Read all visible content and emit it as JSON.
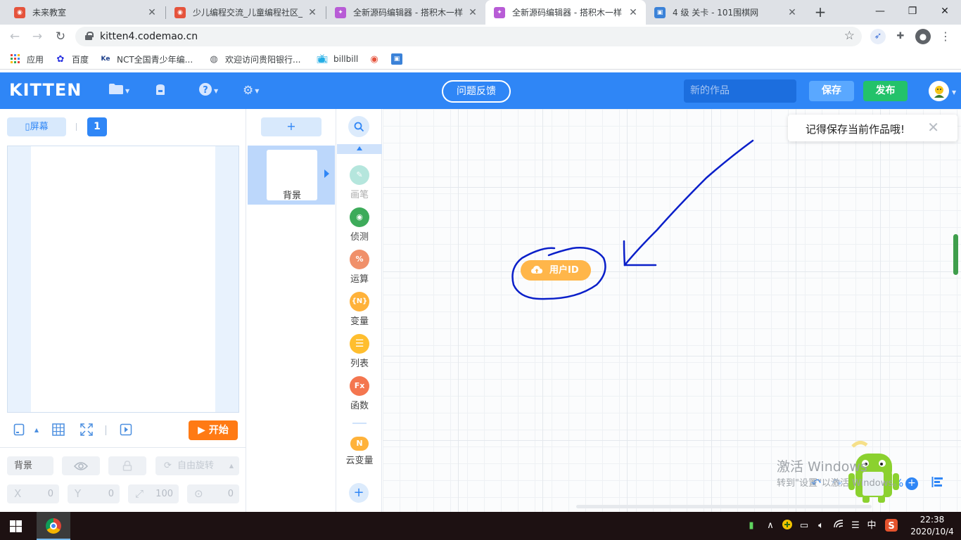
{
  "browser": {
    "tabs": [
      {
        "title": "未来教室",
        "active": false
      },
      {
        "title": "少儿编程交流_儿童编程社区_",
        "active": false
      },
      {
        "title": "全新源码编辑器 - 搭积木一样",
        "active": false
      },
      {
        "title": "全新源码编辑器 - 搭积木一样",
        "active": true
      },
      {
        "title": "4 级 关卡 - 101围棋网",
        "active": false
      }
    ],
    "new_tab": "+",
    "url": "kitten4.codemao.cn",
    "bookmarks": [
      {
        "label": "应用",
        "icon": "apps-grid-icon"
      },
      {
        "label": "百度",
        "icon": "baidu-paw-icon"
      },
      {
        "label": "NCT全国青少年编...",
        "icon": "nct-icon"
      },
      {
        "label": "欢迎访问贵阳银行...",
        "icon": "globe-icon"
      },
      {
        "label": "billbill",
        "icon": "bilibili-tv-icon"
      },
      {
        "label": "",
        "icon": "codemao-icon"
      },
      {
        "label": "",
        "icon": "image-icon"
      }
    ]
  },
  "app": {
    "logo": "KITTEN",
    "feedback": "问题反馈",
    "project_name_placeholder": "新的作品",
    "save": "保存",
    "publish": "发布",
    "accent": "#2f86f6"
  },
  "stage": {
    "screen_button": "屏幕",
    "page_number": "1",
    "start_button": "开始",
    "props": {
      "name": "背景",
      "rotate": "自由旋转",
      "x_label": "X",
      "x_value": "0",
      "y_label": "Y",
      "y_value": "0",
      "size_value": "100",
      "direction_value": "0"
    }
  },
  "sprites": {
    "add": "+",
    "items": [
      {
        "label": "背景",
        "selected": true
      }
    ]
  },
  "categories": [
    {
      "label": "画笔",
      "color": "#5cc9b4",
      "glyph": "✎",
      "faded": true
    },
    {
      "label": "侦测",
      "color": "#3dab5a",
      "glyph": "◉",
      "faded": false
    },
    {
      "label": "运算",
      "color": "#f0906a",
      "glyph": "%",
      "faded": false
    },
    {
      "label": "变量",
      "color": "#ffb23a",
      "glyph": "{N}",
      "faded": false
    },
    {
      "label": "列表",
      "color": "#ffbe2e",
      "glyph": "☰",
      "faded": false
    },
    {
      "label": "函数",
      "color": "#f4764f",
      "glyph": "Fx",
      "faded": false
    },
    {
      "label": "云变量",
      "color": "#ffb23a",
      "glyph": "N",
      "faded": false
    }
  ],
  "workspace": {
    "toast": "记得保存当前作品哦!",
    "block_label": "用户ID",
    "block_color": "#ffb64a",
    "annotation_color": "#0a1fc9",
    "watermark_title": "激活 Windows",
    "watermark_sub": "转到\"设置\"以激活 Windows。",
    "zoom_suffix": "%"
  },
  "taskbar": {
    "ime": "中",
    "time": "22:38",
    "date": "2020/10/4"
  }
}
